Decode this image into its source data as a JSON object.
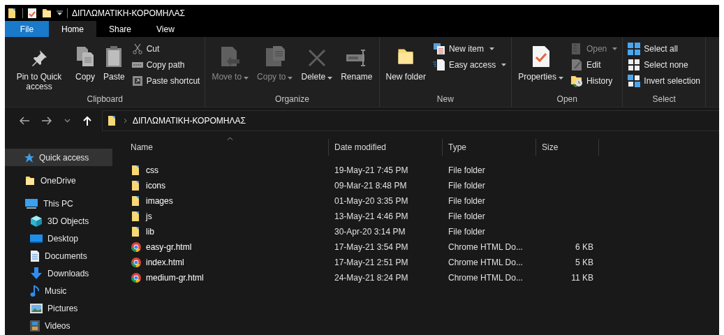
{
  "window": {
    "title": "ΔΙΠΛΩΜΑΤΙΚΗ-ΚΟΡΟΜΗΛΑΣ"
  },
  "ribbon_tabs": [
    {
      "label": "File",
      "kind": "file",
      "selected": false
    },
    {
      "label": "Home",
      "kind": "tab",
      "selected": true
    },
    {
      "label": "Share",
      "kind": "tab",
      "selected": false
    },
    {
      "label": "View",
      "kind": "tab",
      "selected": false
    }
  ],
  "ribbon_groups": [
    {
      "label": "Clipboard",
      "items": [
        {
          "kind": "large",
          "label": "Pin to Quick access",
          "dropdown": false,
          "disabled": false
        },
        {
          "kind": "large",
          "label": "Copy",
          "dropdown": false,
          "disabled": false
        },
        {
          "kind": "large",
          "label": "Paste",
          "dropdown": false,
          "disabled": false
        },
        {
          "kind": "stack",
          "items": [
            {
              "label": "Cut",
              "dropdown": false,
              "disabled": false
            },
            {
              "label": "Copy path",
              "dropdown": false,
              "disabled": false
            },
            {
              "label": "Paste shortcut",
              "dropdown": false,
              "disabled": false
            }
          ]
        }
      ]
    },
    {
      "label": "Organize",
      "items": [
        {
          "kind": "large",
          "label": "Move to",
          "dropdown": true,
          "disabled": true
        },
        {
          "kind": "large",
          "label": "Copy to",
          "dropdown": true,
          "disabled": true
        },
        {
          "kind": "large",
          "label": "Delete",
          "dropdown": true,
          "disabled": false
        },
        {
          "kind": "large",
          "label": "Rename",
          "dropdown": false,
          "disabled": false
        }
      ]
    },
    {
      "label": "New",
      "items": [
        {
          "kind": "large",
          "label": "New folder",
          "dropdown": false,
          "disabled": false
        },
        {
          "kind": "stack",
          "items": [
            {
              "label": "New item",
              "dropdown": true,
              "disabled": false
            },
            {
              "label": "Easy access",
              "dropdown": true,
              "disabled": false
            }
          ]
        }
      ]
    },
    {
      "label": "Open",
      "items": [
        {
          "kind": "large",
          "label": "Properties",
          "dropdown": true,
          "disabled": false
        },
        {
          "kind": "stack",
          "items": [
            {
              "label": "Open",
              "dropdown": true,
              "disabled": true
            },
            {
              "label": "Edit",
              "dropdown": false,
              "disabled": false
            },
            {
              "label": "History",
              "dropdown": false,
              "disabled": false
            }
          ]
        }
      ]
    },
    {
      "label": "Select",
      "items": [
        {
          "kind": "stack",
          "items": [
            {
              "label": "Select all",
              "dropdown": false,
              "disabled": false
            },
            {
              "label": "Select none",
              "dropdown": false,
              "disabled": false
            },
            {
              "label": "Invert selection",
              "dropdown": false,
              "disabled": false
            }
          ]
        }
      ]
    }
  ],
  "address_bar": {
    "path": [
      "ΔΙΠΛΩΜΑΤΙΚΗ-ΚΟΡΟΜΗΛΑΣ"
    ]
  },
  "sidebar": {
    "items": [
      {
        "label": "Quick access",
        "selected": true
      },
      {
        "label": "OneDrive",
        "selected": false
      },
      {
        "label": "This PC",
        "selected": false,
        "children": [
          {
            "label": "3D Objects",
            "selected": false
          },
          {
            "label": "Desktop",
            "selected": false
          },
          {
            "label": "Documents",
            "selected": false
          },
          {
            "label": "Downloads",
            "selected": false
          },
          {
            "label": "Music",
            "selected": false
          },
          {
            "label": "Pictures",
            "selected": false
          },
          {
            "label": "Videos",
            "selected": false
          }
        ]
      }
    ]
  },
  "table": {
    "columns": [
      {
        "label": "Name",
        "sorted": true
      },
      {
        "label": "Date modified",
        "sorted": false
      },
      {
        "label": "Type",
        "sorted": false
      },
      {
        "label": "Size",
        "sorted": false
      }
    ],
    "rows": [
      {
        "kind": "folder",
        "name": "css",
        "date": "19-May-21 7:45 PM",
        "type": "File folder"
      },
      {
        "kind": "folder",
        "name": "icons",
        "date": "09-Mar-21 8:48 PM",
        "type": "File folder"
      },
      {
        "kind": "folder",
        "name": "images",
        "date": "01-May-20 3:35 PM",
        "type": "File folder"
      },
      {
        "kind": "folder",
        "name": "js",
        "date": "13-May-21 4:46 PM",
        "type": "File folder"
      },
      {
        "kind": "folder",
        "name": "lib",
        "date": "30-Apr-20 3:14 PM",
        "type": "File folder"
      },
      {
        "kind": "html",
        "name": "easy-gr.html",
        "date": "17-May-21 3:54 PM",
        "type": "Chrome HTML Do...",
        "size": "6 KB"
      },
      {
        "kind": "html",
        "name": "index.html",
        "date": "17-May-21 2:51 PM",
        "type": "Chrome HTML Do...",
        "size": "5 KB"
      },
      {
        "kind": "html",
        "name": "medium-gr.html",
        "date": "24-May-21 8:24 PM",
        "type": "Chrome HTML Do...",
        "size": "11 KB"
      }
    ]
  }
}
